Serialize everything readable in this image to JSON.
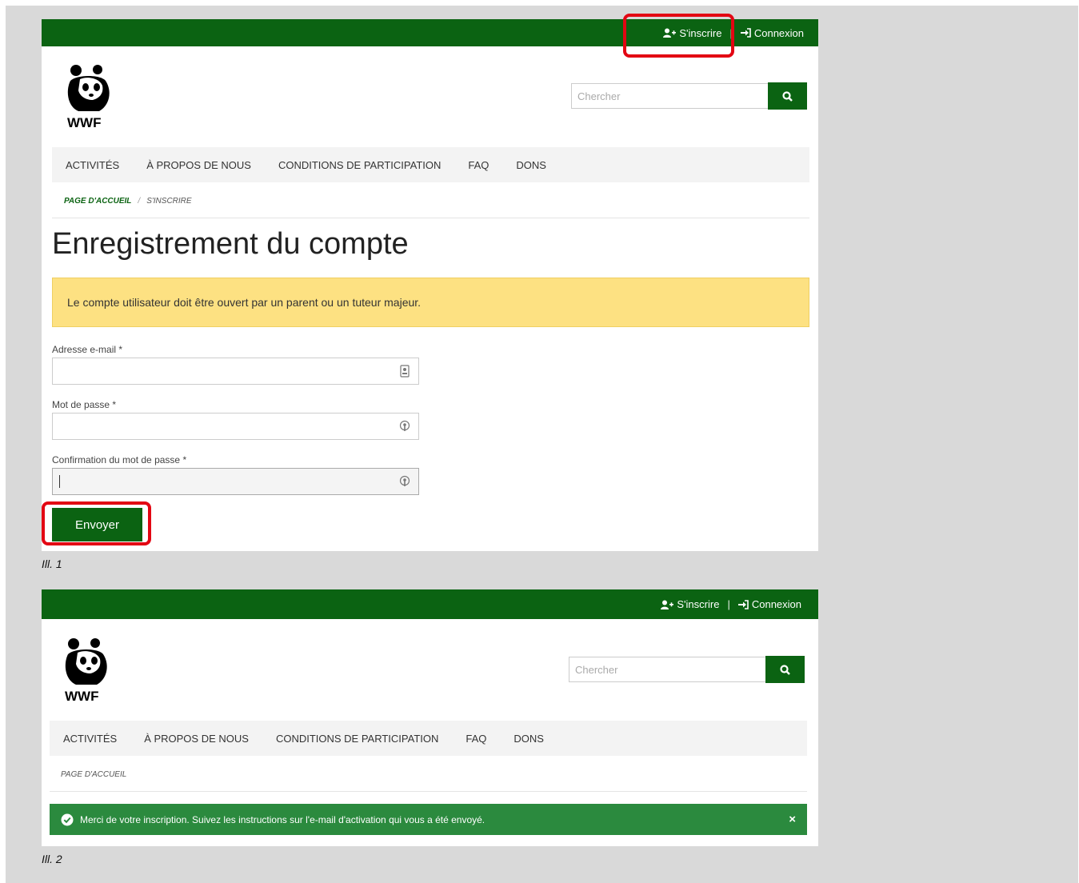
{
  "colors": {
    "brand_green": "#0b6312",
    "highlight_red": "#e30613",
    "warning_bg": "#fde182",
    "success_bg": "#2b8a3e"
  },
  "ill1": {
    "header": {
      "signup": "S'inscrire",
      "login": "Connexion",
      "separator": "|"
    },
    "logo_text": "WWF",
    "search": {
      "placeholder": "Chercher",
      "icon": "search-icon"
    },
    "nav": [
      "ACTIVITÉS",
      "À PROPOS DE NOUS",
      "CONDITIONS DE PARTICIPATION",
      "FAQ",
      "DONS"
    ],
    "breadcrumb": {
      "home": "PAGE D'ACCUEIL",
      "separator": "/",
      "current": "S'INSCRIRE"
    },
    "title": "Enregistrement du compte",
    "warning": "Le compte utilisateur doit être ouvert par un parent ou un tuteur majeur.",
    "fields": {
      "email_label": "Adresse e-mail",
      "password_label": "Mot de passe",
      "confirm_label": "Confirmation du mot de passe",
      "required_mark": "*"
    },
    "submit": "Envoyer",
    "caption": "Ill. 1"
  },
  "ill2": {
    "header": {
      "signup": "S'inscrire",
      "login": "Connexion",
      "separator": "|"
    },
    "logo_text": "WWF",
    "search": {
      "placeholder": "Chercher",
      "icon": "search-icon"
    },
    "nav": [
      "ACTIVITÉS",
      "À PROPOS DE NOUS",
      "CONDITIONS DE PARTICIPATION",
      "FAQ",
      "DONS"
    ],
    "breadcrumb": {
      "home": "PAGE D'ACCUEIL"
    },
    "success": "Merci de votre inscription. Suivez les instructions sur l'e-mail d'activation qui vous a été envoyé.",
    "close": "×",
    "caption": "Ill. 2"
  }
}
